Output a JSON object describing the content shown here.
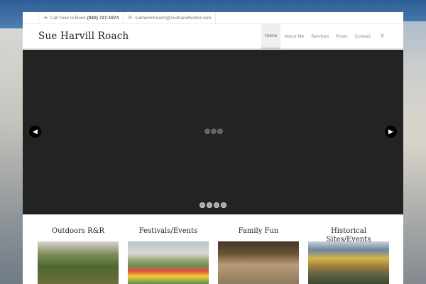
{
  "site": {
    "title": "Sue Harvill Roach"
  },
  "topbar": {
    "phone_label": "Call Now to Book",
    "phone_number": "(940) 727-1974",
    "email": "sueharvillroach@sueharvillwriter.com"
  },
  "nav": {
    "items": [
      "Home",
      "About Me",
      "Services",
      "Posts",
      "Contact"
    ],
    "active": "Home"
  },
  "slider": {
    "prev_glyph": "◀",
    "next_glyph": "▶",
    "pagination_count": 4
  },
  "categories": [
    {
      "title": "Outdoors R&R"
    },
    {
      "title": "Festivals/Events"
    },
    {
      "title": "Family Fun"
    },
    {
      "title": "Historical Sites/Events"
    }
  ],
  "icons": {
    "phone": "phone-arrow-icon",
    "email": "envelope-icon",
    "search": "search-icon"
  },
  "colors": {
    "slider_bg": "#232323",
    "nav_active_bg": "#efefef"
  }
}
